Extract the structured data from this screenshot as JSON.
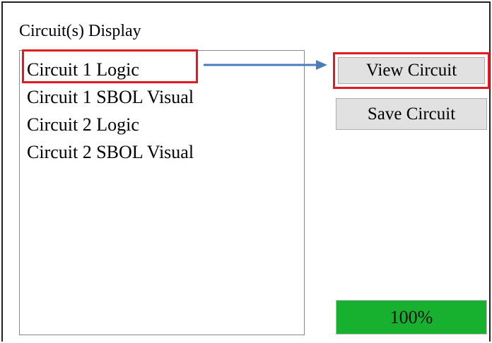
{
  "group": {
    "title": "Circuit(s) Display"
  },
  "list": {
    "items": [
      {
        "label": "Circuit 1 Logic",
        "selected": true
      },
      {
        "label": "Circuit 1 SBOL Visual",
        "selected": false
      },
      {
        "label": "Circuit 2 Logic",
        "selected": false
      },
      {
        "label": "Circuit 2 SBOL Visual",
        "selected": false
      }
    ]
  },
  "buttons": {
    "view_label": "View Circuit",
    "save_label": "Save Circuit"
  },
  "progress": {
    "value": 1.0,
    "label": "100%",
    "fill_color": "#17b02f"
  },
  "annotation": {
    "highlight_color": "#e11b22",
    "arrow_color": "#4a7ebb",
    "arrow_icon": "right-arrow-icon"
  }
}
